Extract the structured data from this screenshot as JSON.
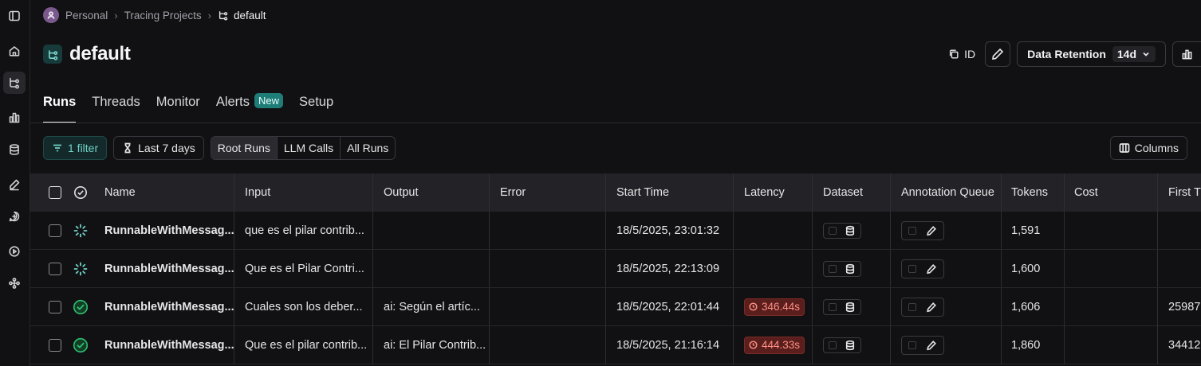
{
  "breadcrumb": {
    "items": [
      "Personal",
      "Tracing Projects"
    ],
    "current": "default"
  },
  "project": {
    "title": "default"
  },
  "header_actions": {
    "id_label": "ID",
    "retention_label": "Data Retention",
    "retention_value": "14d"
  },
  "tabs": [
    {
      "label": "Runs",
      "active": true
    },
    {
      "label": "Threads"
    },
    {
      "label": "Monitor"
    },
    {
      "label": "Alerts",
      "badge": "New"
    },
    {
      "label": "Setup"
    }
  ],
  "filters": {
    "filter_label": "1 filter",
    "time_label": "Last 7 days",
    "run_types": [
      "Root Runs",
      "LLM Calls",
      "All Runs"
    ],
    "selected_run_type": "Root Runs",
    "columns_label": "Columns"
  },
  "table": {
    "headers": {
      "name": "Name",
      "input": "Input",
      "output": "Output",
      "error": "Error",
      "start_time": "Start Time",
      "latency": "Latency",
      "dataset": "Dataset",
      "annotation_queue": "Annotation Queue",
      "tokens": "Tokens",
      "cost": "Cost",
      "first_token": "First T"
    },
    "rows": [
      {
        "status": "running",
        "name": "RunnableWithMessag...",
        "input": "que es el pilar contrib...",
        "output": "",
        "error": "",
        "start_time": "18/5/2025, 23:01:32",
        "latency": "",
        "tokens": "1,591",
        "cost": "",
        "first_token": ""
      },
      {
        "status": "running",
        "name": "RunnableWithMessag...",
        "input": "Que es el Pilar Contri...",
        "output": "",
        "error": "",
        "start_time": "18/5/2025, 22:13:09",
        "latency": "",
        "tokens": "1,600",
        "cost": "",
        "first_token": ""
      },
      {
        "status": "success",
        "name": "RunnableWithMessag...",
        "input": "Cuales son los deber...",
        "output": "ai: Según el artíc...",
        "error": "",
        "start_time": "18/5/2025, 22:01:44",
        "latency": "346.44s",
        "tokens": "1,606",
        "cost": "",
        "first_token": "25987"
      },
      {
        "status": "success",
        "name": "RunnableWithMessag...",
        "input": "Que es el pilar contrib...",
        "output": "ai: El Pilar Contrib...",
        "error": "",
        "start_time": "18/5/2025, 21:16:14",
        "latency": "444.33s",
        "tokens": "1,860",
        "cost": "",
        "first_token": "34412"
      }
    ]
  },
  "colors": {
    "accent": "#1f7d77",
    "filter_text": "#6fd1c8",
    "latency_bg": "#5a1f1c",
    "latency_text": "#ff8f86",
    "success": "#2fbf71"
  }
}
